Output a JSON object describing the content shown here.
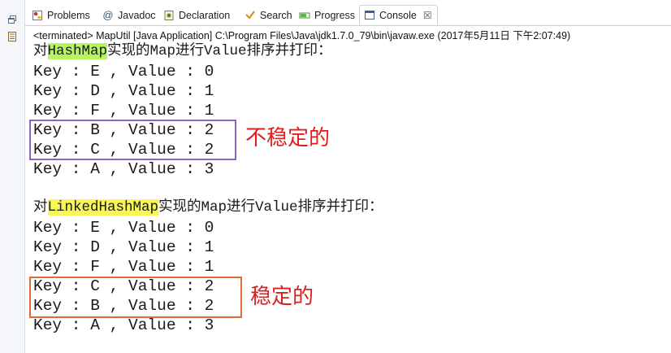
{
  "tabs": [
    {
      "label": "Problems",
      "icon": "problems-icon"
    },
    {
      "label": "Javadoc",
      "icon": "at-sign-icon"
    },
    {
      "label": "Declaration",
      "icon": "declaration-icon"
    },
    {
      "label": "Search",
      "icon": "search-icon"
    },
    {
      "label": "Progress",
      "icon": "progress-icon"
    },
    {
      "label": "Console",
      "icon": "console-icon",
      "close": "☒"
    }
  ],
  "status_line": "<terminated> MapUtil [Java Application] C:\\Program Files\\Java\\jdk1.7.0_79\\bin\\javaw.exe (2017年5月11日 下午2:07:49)",
  "section1": {
    "prefix": "对",
    "highlight": "HashMap",
    "suffix": "实现的Map进行Value排序并打印：",
    "lines": [
      "Key : E , Value : 0",
      "Key : D , Value : 1",
      "Key : F , Value : 1",
      "Key : B , Value : 2",
      "Key : C , Value : 2",
      "Key : A , Value : 3"
    ],
    "annotation": "不稳定的"
  },
  "section2": {
    "prefix": "对",
    "highlight": "LinkedHashMap",
    "suffix": "实现的Map进行Value排序并打印：",
    "lines": [
      "Key : E , Value : 0",
      "Key : D , Value : 1",
      "Key : F , Value : 1",
      "Key : C , Value : 2",
      "Key : B , Value : 2",
      "Key : A , Value : 3"
    ],
    "annotation": "稳定的"
  },
  "colors": {
    "highlight_green": "#b5f562",
    "highlight_yellow": "#f8f556",
    "box_purple": "#8b63c4",
    "box_orange": "#e06b36",
    "annotation_red": "#dd1f1f"
  }
}
